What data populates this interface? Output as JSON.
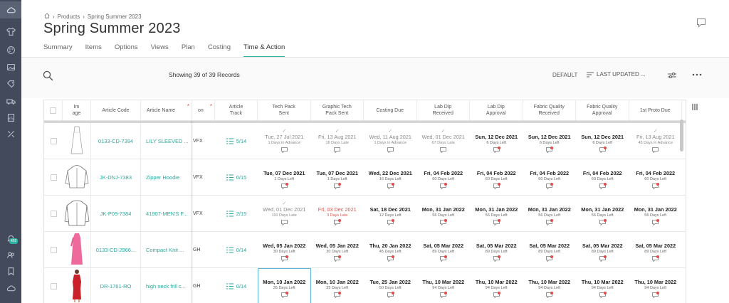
{
  "breadcrumb": {
    "products": "Products",
    "current": "Spring Summer 2023",
    "sep": "›"
  },
  "page_title": "Spring Summer 2023",
  "tabs": [
    {
      "label": "Summary",
      "active": false
    },
    {
      "label": "Items",
      "active": false
    },
    {
      "label": "Options",
      "active": false
    },
    {
      "label": "Views",
      "active": false
    },
    {
      "label": "Plan",
      "active": false
    },
    {
      "label": "Costing",
      "active": false
    },
    {
      "label": "Time & Action",
      "active": true
    }
  ],
  "toolbar": {
    "records": "Showing 39 of 39 Records",
    "default_view": "DEFAULT",
    "sort": "LAST UPDATED ..."
  },
  "sidebar": {
    "badge": "402"
  },
  "columns": {
    "image": "Im\nage",
    "article_code": "Article Code",
    "article_name": "Article Name",
    "frag": "on",
    "article_track": "Article\nTrack",
    "milestones": [
      "Tech Pack\nSent",
      "Graphic Tech\nPack Sent",
      "Costing Due",
      "Lab Dip\nReceived",
      "Lab Dip\nApproval",
      "Fabric Quality\nReceived",
      "Fabric Quality\nApproval",
      "1st Proto Due"
    ]
  },
  "rows": [
    {
      "code": "0133-CD-7394",
      "name": "LILY SLEEVED ...",
      "frag": "VFX",
      "track": "5/14",
      "image": "line-dress",
      "cells": [
        {
          "date": "Tue, 27 Jul 2021",
          "sub": "1 Days in Advance",
          "state": "done"
        },
        {
          "date": "Fri, 13 Aug 2021",
          "sub": "16 Days Late",
          "state": "done"
        },
        {
          "date": "Wed, 11 Aug 2021",
          "sub": "1 Days in Advance",
          "state": "done"
        },
        {
          "date": "Wed, 01 Dec 2021",
          "sub": "67 Days Late",
          "state": "done"
        },
        {
          "date": "Sun, 12 Dec 2021",
          "sub": "6 Days Left",
          "state": "open"
        },
        {
          "date": "Sun, 12 Dec 2021",
          "sub": "6 Days Left",
          "state": "open"
        },
        {
          "date": "Sun, 12 Dec 2021",
          "sub": "6 Days Left",
          "state": "open"
        },
        {
          "date": "Fri, 13 Aug 2021",
          "sub": "45 Days in Advance",
          "state": "done"
        }
      ]
    },
    {
      "code": "JK-DNJ-7383",
      "name": "Zipper Hoodie",
      "frag": "VFX",
      "track": "0/15",
      "image": "line-hoodie",
      "cells": [
        {
          "date": "Tue, 07 Dec 2021",
          "sub": "1 Days Left",
          "state": "open"
        },
        {
          "date": "Tue, 07 Dec 2021",
          "sub": "1 Days Left",
          "state": "open"
        },
        {
          "date": "Wed, 22 Dec 2021",
          "sub": "16 Days Left",
          "state": "open"
        },
        {
          "date": "Fri, 04 Feb 2022",
          "sub": "60 Days Left",
          "state": "open"
        },
        {
          "date": "Fri, 04 Feb 2022",
          "sub": "60 Days Left",
          "state": "open"
        },
        {
          "date": "Fri, 04 Feb 2022",
          "sub": "60 Days Left",
          "state": "open"
        },
        {
          "date": "Fri, 04 Feb 2022",
          "sub": "60 Days Left",
          "state": "open"
        },
        {
          "date": "Fri, 04 Feb 2022",
          "sub": "60 Days Left",
          "state": "open"
        }
      ]
    },
    {
      "code": "JK-P09-7384",
      "name": "41907-MEN'S F...",
      "frag": "VFX",
      "track": "2/15",
      "image": "line-jacket",
      "cells": [
        {
          "date": "Wed, 01 Dec 2021",
          "sub": "110 Days Late",
          "state": "done"
        },
        {
          "date": "Fri, 03 Dec 2021",
          "sub": "3 Days Late",
          "state": "late"
        },
        {
          "date": "Sat, 18 Dec 2021",
          "sub": "12 Days Left",
          "state": "open"
        },
        {
          "date": "Mon, 31 Jan 2022",
          "sub": "56 Days Left",
          "state": "open"
        },
        {
          "date": "Mon, 31 Jan 2022",
          "sub": "56 Days Left",
          "state": "open"
        },
        {
          "date": "Mon, 31 Jan 2022",
          "sub": "56 Days Left",
          "state": "open"
        },
        {
          "date": "Mon, 31 Jan 2022",
          "sub": "56 Days Left",
          "state": "open"
        },
        {
          "date": "Mon, 31 Jan 2022",
          "sub": "56 Days Left",
          "state": "open"
        }
      ]
    },
    {
      "code": "0133-CD-2966...",
      "name": "Compact Knit ...",
      "frag": "GH",
      "track": "0/14",
      "image": "pink-dress",
      "cells": [
        {
          "date": "Wed, 05 Jan 2022",
          "sub": "30 Days Left",
          "state": "open"
        },
        {
          "date": "Wed, 05 Jan 2022",
          "sub": "30 Days Left",
          "state": "open"
        },
        {
          "date": "Thu, 20 Jan 2022",
          "sub": "45 Days Left",
          "state": "open"
        },
        {
          "date": "Sat, 05 Mar 2022",
          "sub": "89 Days Left",
          "state": "open"
        },
        {
          "date": "Sat, 05 Mar 2022",
          "sub": "89 Days Left",
          "state": "open"
        },
        {
          "date": "Sat, 05 Mar 2022",
          "sub": "89 Days Left",
          "state": "open"
        },
        {
          "date": "Sat, 05 Mar 2022",
          "sub": "89 Days Left",
          "state": "open"
        },
        {
          "date": "Sat, 05 Mar 2022",
          "sub": "89 Days Left",
          "state": "open"
        }
      ]
    },
    {
      "code": "DR-1761-RO",
      "name": "high neck frill c...",
      "frag": "GH",
      "track": "0/14",
      "image": "red-dress",
      "cells": [
        {
          "date": "Mon, 10 Jan 2022",
          "sub": "35 Days Left",
          "state": "open"
        },
        {
          "date": "Mon, 10 Jan 2022",
          "sub": "35 Days Left",
          "state": "open"
        },
        {
          "date": "Tue, 25 Jan 2022",
          "sub": "50 Days Left",
          "state": "open"
        },
        {
          "date": "Thu, 10 Mar 2022",
          "sub": "94 Days Left",
          "state": "open"
        },
        {
          "date": "Thu, 10 Mar 2022",
          "sub": "94 Days Left",
          "state": "open"
        },
        {
          "date": "Thu, 10 Mar 2022",
          "sub": "94 Days Left",
          "state": "open"
        },
        {
          "date": "Thu, 10 Mar 2022",
          "sub": "94 Days Left",
          "state": "open"
        },
        {
          "date": "Thu, 10 Mar 2022",
          "sub": "94 Days Left",
          "state": "open"
        }
      ]
    }
  ],
  "colors": {
    "accent": "#2bb3a6",
    "sidebar": "#434a5c",
    "late": "#d9534f",
    "dot": "#e24b4b"
  }
}
